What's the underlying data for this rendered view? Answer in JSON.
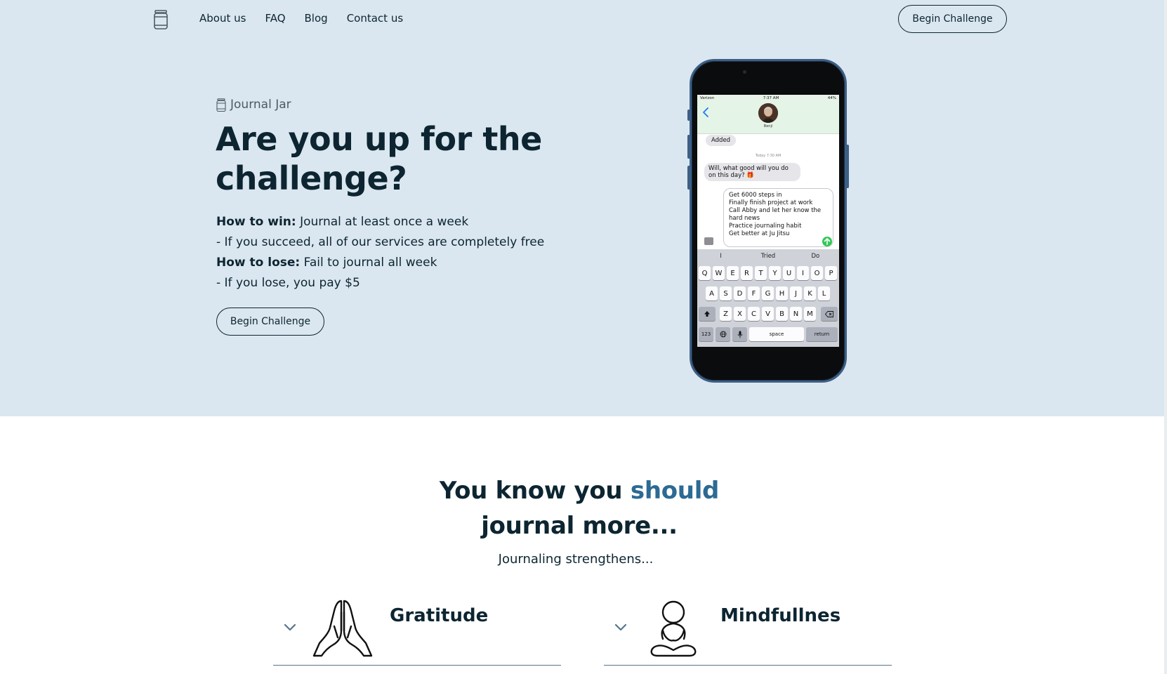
{
  "nav": {
    "logo_icon": "jar-icon",
    "links": [
      "About us",
      "FAQ",
      "Blog",
      "Contact us"
    ],
    "cta_label": "Begin Challenge"
  },
  "hero": {
    "brand_icon": "jar-icon",
    "brand_label": "Journal Jar",
    "title": "Are you up for the challenge?",
    "win_label": "How to win:",
    "win_text": " Journal at least once a week",
    "win_detail": "- If you succeed, all of our services are completely free",
    "lose_label": "How to lose:",
    "lose_text": " Fail to journal all week",
    "lose_detail": "- If you lose, you pay $5",
    "cta_label": "Begin Challenge"
  },
  "phone": {
    "status_carrier": "Verizon",
    "status_time": "7:37 AM",
    "status_battery": "44%",
    "contact_name": "Benji",
    "added_label": "Added",
    "timestamp": "Today 7:30 AM",
    "question": "Will, what good will you do on this day? 🎁",
    "draft_lines": [
      "Get 6000 steps in",
      "Finally finish project at work",
      "Call Abby and let her know the hard news",
      "Practice journaling habit",
      "Get better at Ju Jitsu"
    ],
    "suggestions": [
      "I",
      "Tried",
      "Do"
    ],
    "keys_row1": [
      "Q",
      "W",
      "E",
      "R",
      "T",
      "Y",
      "U",
      "I",
      "O",
      "P"
    ],
    "keys_row2": [
      "A",
      "S",
      "D",
      "F",
      "G",
      "H",
      "J",
      "K",
      "L"
    ],
    "keys_row3": [
      "Z",
      "X",
      "C",
      "V",
      "B",
      "N",
      "M"
    ],
    "key_123": "123",
    "key_space": "space",
    "key_return": "return"
  },
  "section": {
    "title_before": "You know you ",
    "title_accent": "should",
    "title_after": " journal more...",
    "subtitle": "Journaling strengthens...",
    "accent_color": "#2c6a94",
    "benefits": [
      {
        "label": "Gratitude",
        "icon": "praying-hands-icon"
      },
      {
        "label": "Mindfullnes",
        "icon": "meditation-icon"
      }
    ]
  }
}
